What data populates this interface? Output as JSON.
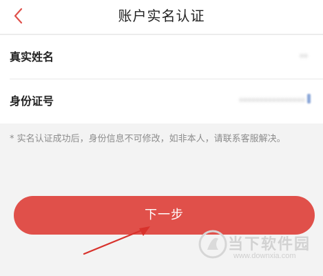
{
  "header": {
    "title": "账户实名认证",
    "back_icon": "chevron-left-icon"
  },
  "form": {
    "rows": [
      {
        "label": "真实姓名",
        "value": "**"
      },
      {
        "label": "身份证号",
        "value": "****************"
      }
    ]
  },
  "notice": {
    "text": "* 实名认证成功后，身份信息不可修改，如非本人，请联系客服解决。"
  },
  "actions": {
    "next_label": "下一步"
  },
  "watermark": {
    "name": "当下软件园",
    "url": "www.downxia.com"
  },
  "colors": {
    "accent": "#e0504a",
    "back_arrow": "#e0504a",
    "annotation_arrow": "#d8322c"
  }
}
